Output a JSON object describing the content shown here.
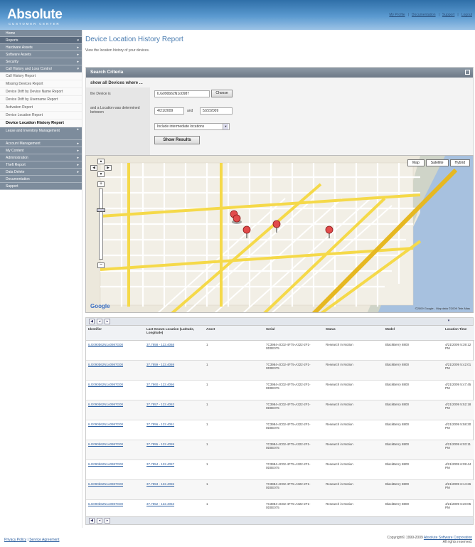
{
  "header": {
    "logo": "Absolute",
    "logo_sub": "CUSTOMER CENTER",
    "links": [
      "My Profile",
      "Documentation",
      "Support",
      "Logout"
    ]
  },
  "sidebar": {
    "items": [
      {
        "label": "Home"
      },
      {
        "label": "Reports",
        "active": true
      },
      {
        "label": "Hardware Assets"
      },
      {
        "label": "Software Assets"
      },
      {
        "label": "Security"
      },
      {
        "label": "Call History and Loss Control"
      }
    ],
    "sub_items": [
      "Call History Report",
      "Missing Devices Report",
      "Device Drift by Device Name Report",
      "Device Drift by Username Report",
      "Activation Report",
      "Device Location Report",
      "Device Location History Report"
    ],
    "items_after": [
      {
        "label": "Lease and Inventory Management",
        "double": true
      },
      {
        "label": "Account Management"
      },
      {
        "label": "My Content"
      },
      {
        "label": "Administration"
      },
      {
        "label": "Theft Report"
      },
      {
        "label": "Data Delete"
      },
      {
        "label": "Documentation"
      },
      {
        "label": "Support"
      }
    ]
  },
  "main": {
    "title": "Device Location History Report",
    "description": "View the location history of your devices."
  },
  "criteria": {
    "header": "Search Criteria",
    "subheader": "show all Devices where ...",
    "device_label": "the Device is",
    "device_value": "ILG090b62N1o0987",
    "choose_label": "Choose",
    "date_label": "and a Location was determined between",
    "date_from": "4/21/2009",
    "date_and": "and",
    "date_to": "5/22/2009",
    "location_option": "Include intermediate locations",
    "show_button": "Show Results"
  },
  "map": {
    "types": [
      "Map",
      "Satellite",
      "Hybrid"
    ],
    "copyright": "©2009 Google - Map data ©2009 Tele Atlas",
    "google": "Google"
  },
  "results": {
    "columns": [
      "Identifier",
      "Last Known Location (Latitude, Longitude)",
      "Asset",
      "Serial",
      "Status",
      "Model",
      "Location Time"
    ],
    "rows": [
      {
        "id": "ILG090b62N1o0987G00",
        "loc": "37.7858 - 122.4068",
        "asset": "1",
        "serial": "7C3984-4C02-4F75-A322-2F1-0D0E075",
        "status": "Research in Motion",
        "model": "BlackBerry 8800",
        "time": "4/21/2009 5:39:12 PM"
      },
      {
        "id": "ILG090b62N1o0987G00",
        "loc": "37.7859 - 122.4069",
        "asset": "1",
        "serial": "7C3984-4C02-4F75-A322-2F1-0D0E075",
        "status": "Research in Motion",
        "model": "BlackBerry 8800",
        "time": "4/21/2009 5:42:01 PM"
      },
      {
        "id": "ILG090b62N1o0987G00",
        "loc": "37.7860 - 122.4066",
        "asset": "1",
        "serial": "7C3984-4C02-4F75-A322-2F1-0D0E075",
        "status": "Research in Motion",
        "model": "BlackBerry 8800",
        "time": "4/21/2009 5:47:45 PM"
      },
      {
        "id": "ILG090b62N1o0987G00",
        "loc": "37.7857 - 122.4063",
        "asset": "1",
        "serial": "7C3984-4C02-4F75-A322-2F1-0D0E075",
        "status": "Research in Motion",
        "model": "BlackBerry 8800",
        "time": "4/21/2009 5:52:18 PM"
      },
      {
        "id": "ILG090b62N1o0987G00",
        "loc": "37.7856 - 122.4061",
        "asset": "1",
        "serial": "7C3984-4C02-4F75-A322-2F1-0D0E075",
        "status": "Research in Motion",
        "model": "BlackBerry 8800",
        "time": "4/21/2009 5:58:30 PM"
      },
      {
        "id": "ILG090b62N1o0987G00",
        "loc": "37.7855 - 122.4059",
        "asset": "1",
        "serial": "7C3984-4C02-4F75-A322-2F1-0D0E075",
        "status": "Research in Motion",
        "model": "BlackBerry 8800",
        "time": "4/21/2009 6:03:11 PM"
      },
      {
        "id": "ILG090b62N1o0987G00",
        "loc": "37.7854 - 122.4057",
        "asset": "1",
        "serial": "7C3984-4C02-4F75-A322-2F1-0D0E075",
        "status": "Research in Motion",
        "model": "BlackBerry 8800",
        "time": "4/21/2009 6:09:44 PM"
      },
      {
        "id": "ILG090b62N1o0987G00",
        "loc": "37.7853 - 122.4055",
        "asset": "1",
        "serial": "7C3984-4C02-4F75-A322-2F1-0D0E075",
        "status": "Research in Motion",
        "model": "BlackBerry 8800",
        "time": "4/21/2009 6:14:26 PM"
      },
      {
        "id": "ILG090b62N1o0987G00",
        "loc": "37.7852 - 122.4053",
        "asset": "1",
        "serial": "7C3984-4C02-4F75-A322-2F1-0D0E075",
        "status": "Research in Motion",
        "model": "BlackBerry 8800",
        "time": "4/21/2009 6:20:05 PM"
      }
    ]
  },
  "footer": {
    "privacy": "Privacy Policy",
    "sep": "|",
    "legal": "Service Agreement",
    "copyright": "Copyright© 1999-2009",
    "company": "Absolute Software Corporation",
    "rights": "All rights reserved."
  }
}
